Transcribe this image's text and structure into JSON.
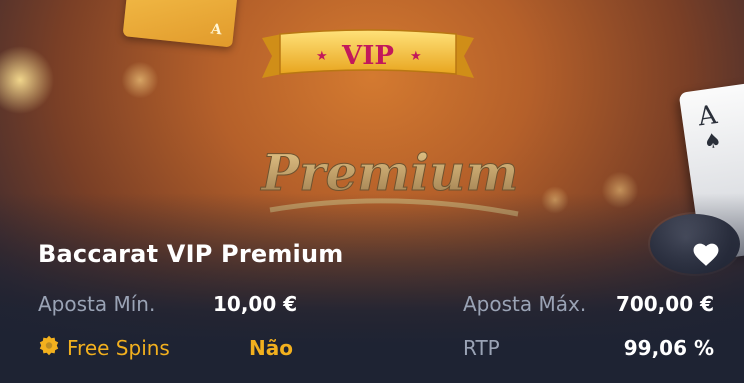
{
  "banner": {
    "vip_text": "VIP",
    "premium_text": "Premium",
    "card_corner": "A",
    "ace_corner": "A",
    "ace_suit": "♠"
  },
  "game": {
    "title": "Baccarat VIP Premium",
    "favorite": true
  },
  "stats": {
    "min_bet_label": "Aposta Mín.",
    "min_bet_value": "10,00 €",
    "max_bet_label": "Aposta Máx.",
    "max_bet_value": "700,00 €",
    "free_spins_label": "Free Spins",
    "free_spins_value": "Não",
    "rtp_label": "RTP",
    "rtp_value": "99,06 %"
  },
  "colors": {
    "accent": "#f2b01e",
    "label": "#9aa3b5",
    "background": "#1e2333",
    "vip_text": "#c2185b"
  },
  "icons": {
    "favorite": "heart-icon",
    "free_spins": "gear-badge-icon"
  }
}
